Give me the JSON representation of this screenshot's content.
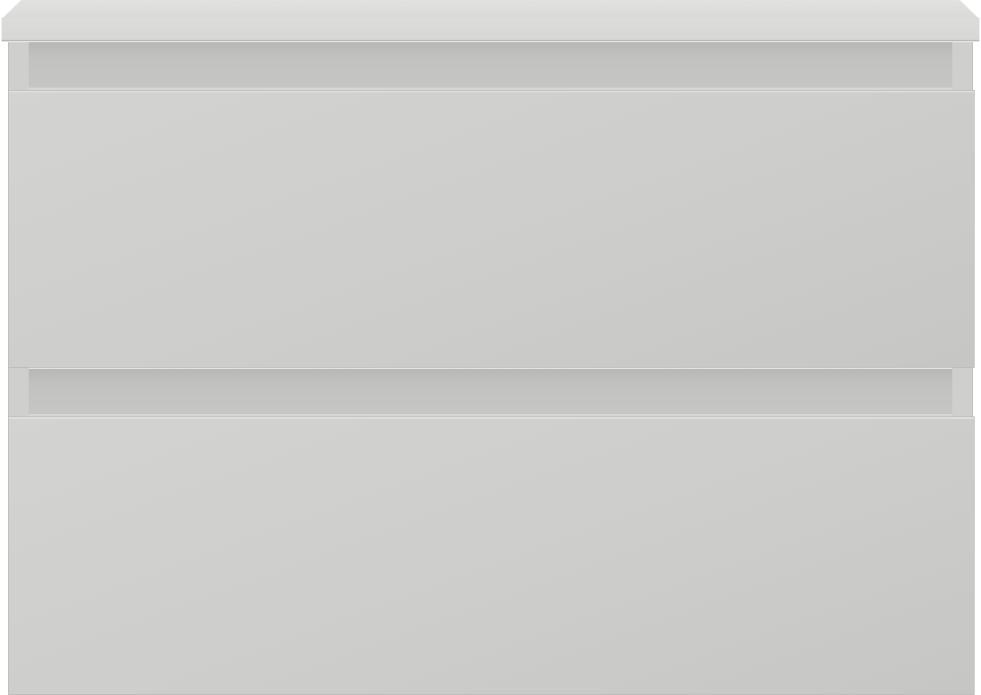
{
  "image": {
    "subject": "bathroom-vanity-cabinet",
    "drawer_count": 2,
    "colors": {
      "countertop": "#dcdcda",
      "drawer_front": "#cdcdcb",
      "groove_shadow": "#b7b7b5",
      "outline": "#bcbcba"
    }
  }
}
